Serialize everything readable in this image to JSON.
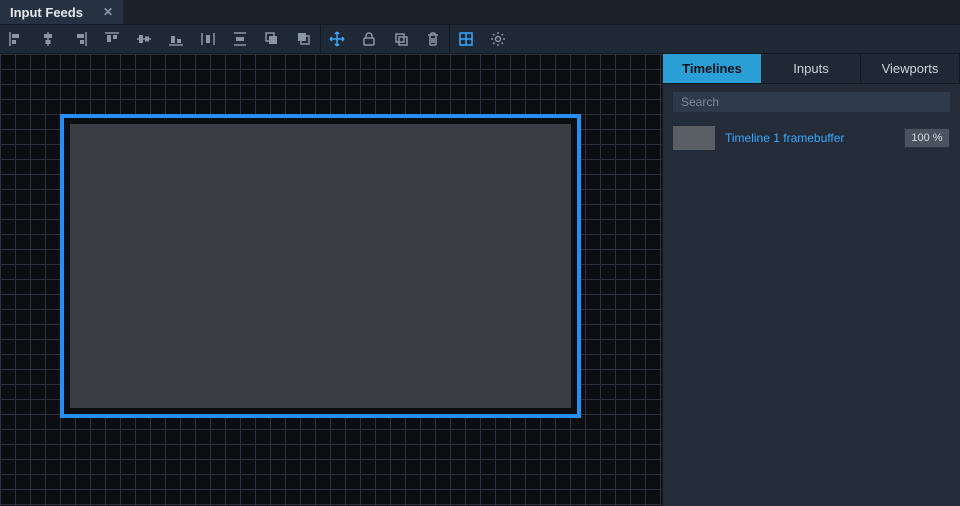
{
  "tab": {
    "title": "Input Feeds"
  },
  "sidepanel": {
    "tabs": {
      "timelines": "Timelines",
      "inputs": "Inputs",
      "viewports": "Viewports"
    },
    "search_placeholder": "Search",
    "items": [
      {
        "name": "Timeline 1 framebuffer",
        "opacity": "100 %"
      }
    ]
  }
}
